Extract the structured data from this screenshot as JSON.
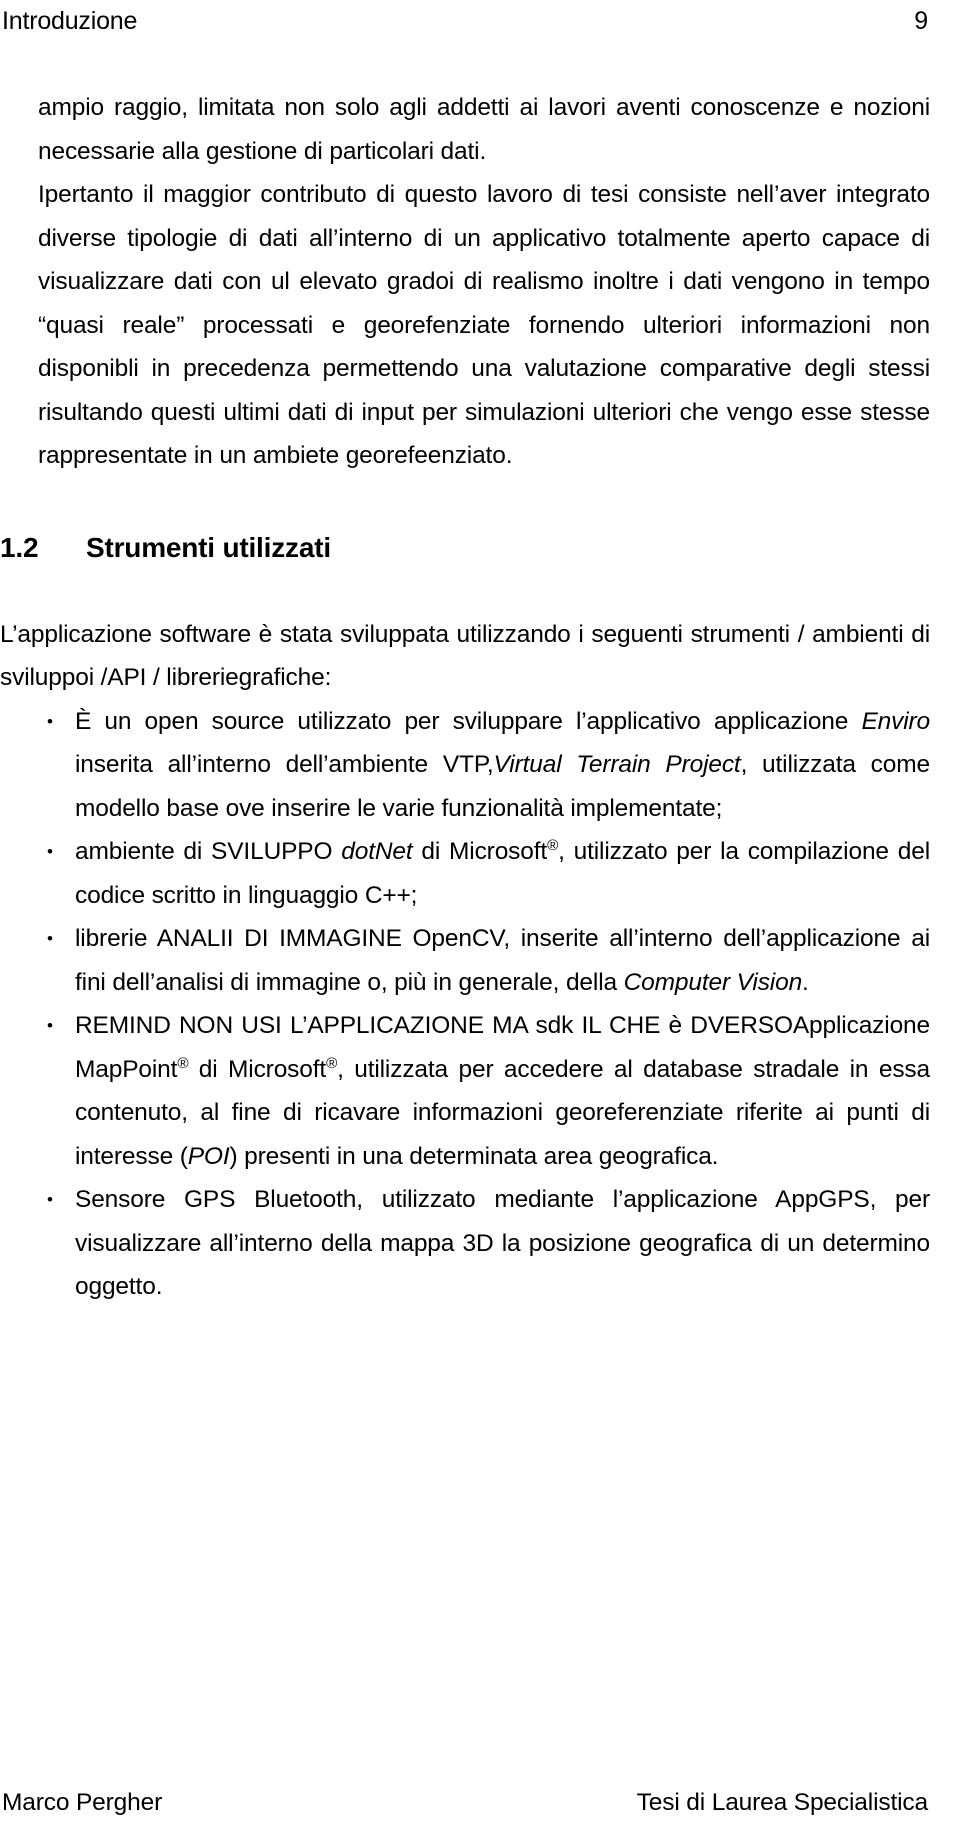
{
  "document": {
    "page_background": "#ffffff",
    "text_color": "#000000"
  },
  "header": {
    "title": "Introduzione",
    "page_number": "9"
  },
  "body": {
    "paragraph_1": "ampio raggio, limitata non solo agli addetti ai lavori aventi conoscenze e nozioni necessarie alla gestione di particolari dati.",
    "paragraph_2": "Ipertanto il maggior contributo di questo lavoro di tesi consiste nell’aver integrato diverse tipologie di dati all’interno di un applicativo totalmente aperto  capace di visualizzare dati con ul elevato gradoi di realismo inoltre i dati vengono in tempo “quasi reale” processati  e georefenziate fornendo ulteriori informazioni non disponibli in precedenza permettendo una valutazione comparative degli stessi risultando questi ultimi dati di input per simulazioni ulteriori che vengo esse stesse rappresentate  in un ambiete georefeenziato."
  },
  "heading": {
    "number": "1.2",
    "text": "Strumenti utilizzati"
  },
  "intro": {
    "paragraph": "L’applicazione software è stata sviluppata utilizzando i seguenti strumenti / ambienti di sviluppoi /API / libreriegrafiche:"
  },
  "bullets": {
    "marker": "•",
    "items": [
      {
        "id": "bullet-enviro-vtp",
        "segments": [
          {
            "text": "È un open source utilizzato per sviluppare l’applicativo applicazione ",
            "style": "normal"
          },
          {
            "text": "Enviro",
            "style": "italic"
          },
          {
            "text": " inserita all’interno dell’ambiente VTP,",
            "style": "normal"
          },
          {
            "text": "Virtual Terrain Project",
            "style": "italic"
          },
          {
            "text": ", utilizzata come modello base ove inserire le varie funzionalità implementate;",
            "style": "normal"
          }
        ]
      },
      {
        "id": "bullet-dotnet",
        "segments": [
          {
            "text": "ambiente di SVILUPPO  ",
            "style": "normal"
          },
          {
            "text": "dotNet",
            "style": "italic"
          },
          {
            "text": " di Microsoft",
            "style": "normal"
          },
          {
            "text": "®",
            "style": "superscript"
          },
          {
            "text": ", utilizzato per la compilazione del codice scritto in linguaggio C++;",
            "style": "normal"
          }
        ]
      },
      {
        "id": "bullet-opencv",
        "segments": [
          {
            "text": "librerie ANALII DI IMMAGINE OpenCV, inserite all’interno dell’applicazione ai fini dell’analisi di immagine o, più in generale, della ",
            "style": "normal"
          },
          {
            "text": "Computer Vision",
            "style": "italic"
          },
          {
            "text": ".",
            "style": "normal"
          }
        ]
      },
      {
        "id": "bullet-mappoint",
        "segments": [
          {
            "text": "REMIND NON USI L’APPLICAZIONE MA sdk IL CHE è DVERSOApplicazione MapPoint",
            "style": "normal"
          },
          {
            "text": "®",
            "style": "superscript"
          },
          {
            "text": " di Microsoft",
            "style": "normal"
          },
          {
            "text": "®",
            "style": "superscript"
          },
          {
            "text": ", utilizzata per accedere al database stradale in essa contenuto, al fine di ricavare informazioni georeferenziate riferite ai punti di interesse (",
            "style": "normal"
          },
          {
            "text": "POI",
            "style": "italic"
          },
          {
            "text": ") presenti in una determinata area geografica.",
            "style": "normal"
          }
        ]
      },
      {
        "id": "bullet-gps",
        "segments": [
          {
            "text": "Sensore GPS Bluetooth, utilizzato mediante l’applicazione AppGPS, per visualizzare all’interno della mappa 3D la posizione geografica di un determino oggetto.",
            "style": "normal"
          }
        ]
      }
    ]
  },
  "footer": {
    "author": "Marco Pergher",
    "document_type": "Tesi di Laurea Specialistica"
  }
}
